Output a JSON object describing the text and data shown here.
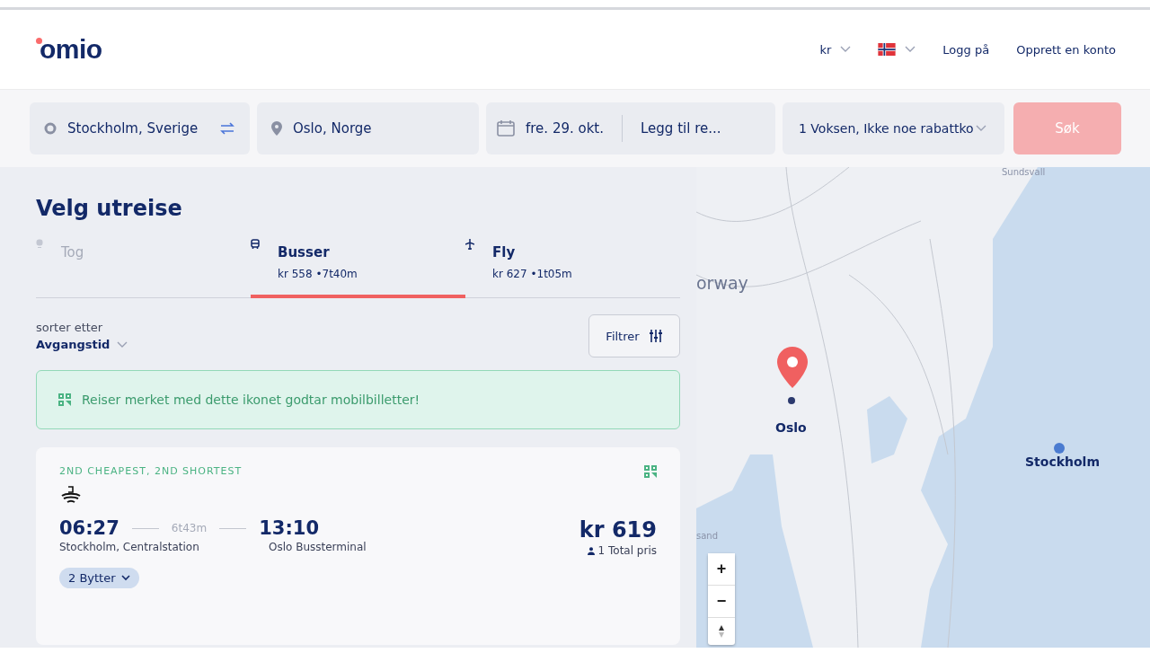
{
  "header": {
    "logo": "omio",
    "currency": "kr",
    "links": [
      "Logg på",
      "Opprett en konto"
    ]
  },
  "search": {
    "from": "Stockholm, Sverige",
    "to": "Oslo, Norge",
    "date": "fre. 29. okt.",
    "return_placeholder": "Legg til re...",
    "passengers": "1 Voksen, Ikke noe rabattko",
    "search_button": "Søk",
    "search_disabled": true
  },
  "results": {
    "title": "Velg utreise",
    "tabs": [
      {
        "kind": "train",
        "label": "Tog",
        "disabled": true,
        "selected": false
      },
      {
        "kind": "bus",
        "label": "Busser",
        "summary": "kr 558 •7t40m",
        "disabled": false,
        "selected": true
      },
      {
        "kind": "plane",
        "label": "Fly",
        "summary": "kr 627 •1t05m",
        "disabled": false,
        "selected": false
      }
    ],
    "sort_label": "sorter etter",
    "sort_value": "Avgangstid",
    "filter_button": "Filtrer",
    "notice": "Reiser merket med dette ikonet godtar mobilbilletter!",
    "trips": [
      {
        "tag": "2ND CHEAPEST, 2ND SHORTEST",
        "depart_time": "06:27",
        "duration": "6t43m",
        "arrive_time": "13:10",
        "depart_station": "Stockholm, Centralstation",
        "arrive_station": "Oslo Bussterminal",
        "price": "kr 619",
        "price_note": "1 Total pris",
        "stops": "2 Bytter"
      }
    ]
  },
  "map": {
    "labels": [
      {
        "kind": "region",
        "text": "Sundsvall"
      },
      {
        "kind": "country",
        "text": "orway"
      },
      {
        "kind": "pin",
        "text": "Oslo"
      },
      {
        "kind": "city",
        "text": "Stockholm"
      },
      {
        "kind": "region",
        "text": "sand"
      }
    ],
    "zoom_in": "+",
    "zoom_out": "−"
  }
}
